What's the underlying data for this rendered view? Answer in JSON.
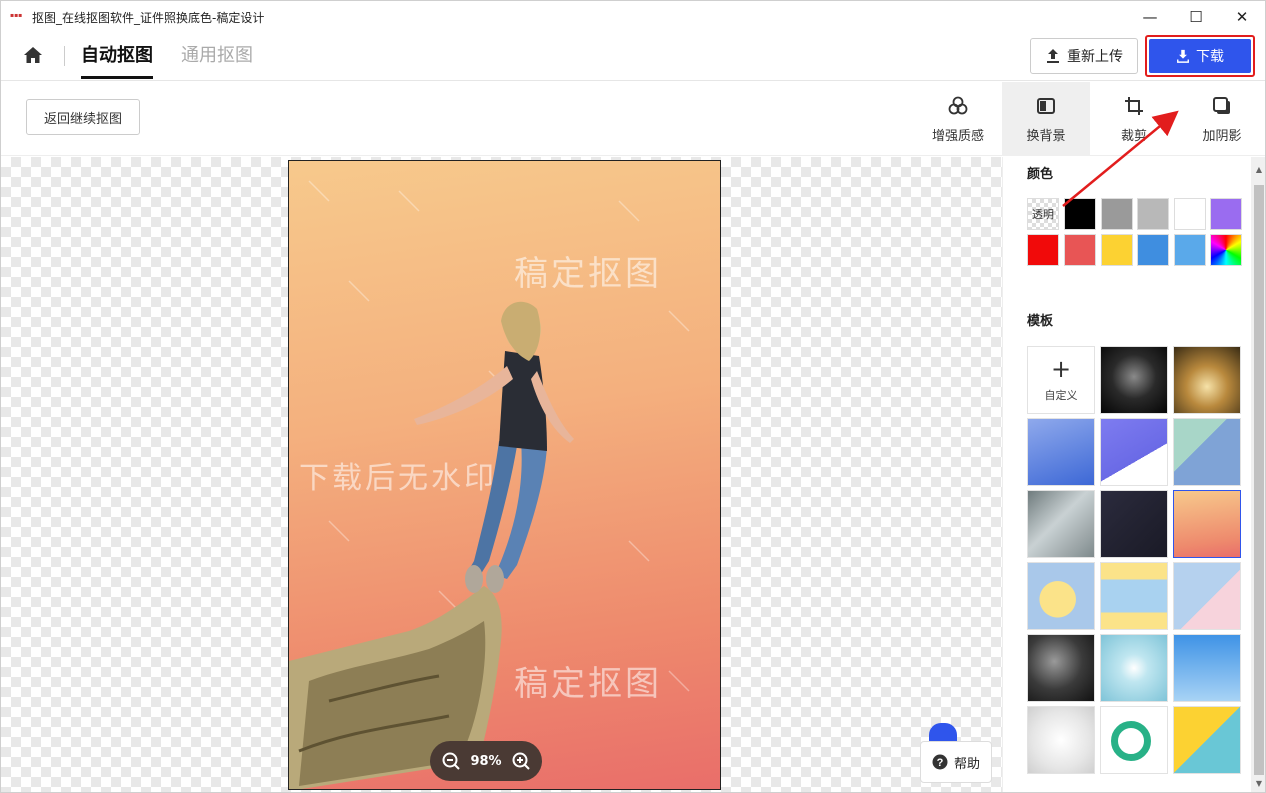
{
  "window": {
    "title": "抠图_在线抠图软件_证件照换底色-稿定设计",
    "minimize": "—",
    "maximize": "☐",
    "close": "✕"
  },
  "nav": {
    "tabs": [
      {
        "label": "自动抠图",
        "active": true
      },
      {
        "label": "通用抠图",
        "active": false
      }
    ],
    "reupload_label": "重新上传",
    "download_label": "下载"
  },
  "toolbar": {
    "back_label": "返回继续抠图",
    "tools": [
      {
        "label": "增强质感",
        "icon": "enhance-icon"
      },
      {
        "label": "换背景",
        "icon": "background-icon",
        "active": true
      },
      {
        "label": "裁剪",
        "icon": "crop-icon"
      },
      {
        "label": "加阴影",
        "icon": "shadow-icon"
      }
    ]
  },
  "canvas": {
    "watermarks": [
      "稿定抠图",
      "下载后无水印",
      "稿定抠图"
    ],
    "zoom_level": "98%",
    "help_label": "帮助"
  },
  "panel": {
    "color_title": "颜色",
    "transparent_label": "透明",
    "colors": [
      "#000000",
      "#9a9a9a",
      "#b8b8b8",
      "#ffffff",
      "#9a6cf0",
      "#f10a0a",
      "#e85555",
      "#fcd232",
      "#3f8ee0",
      "#5aa9ea"
    ],
    "template_title": "模板",
    "custom_label": "自定义"
  },
  "colors": {
    "accent": "#2f55ec",
    "highlight": "#e21d1d"
  }
}
